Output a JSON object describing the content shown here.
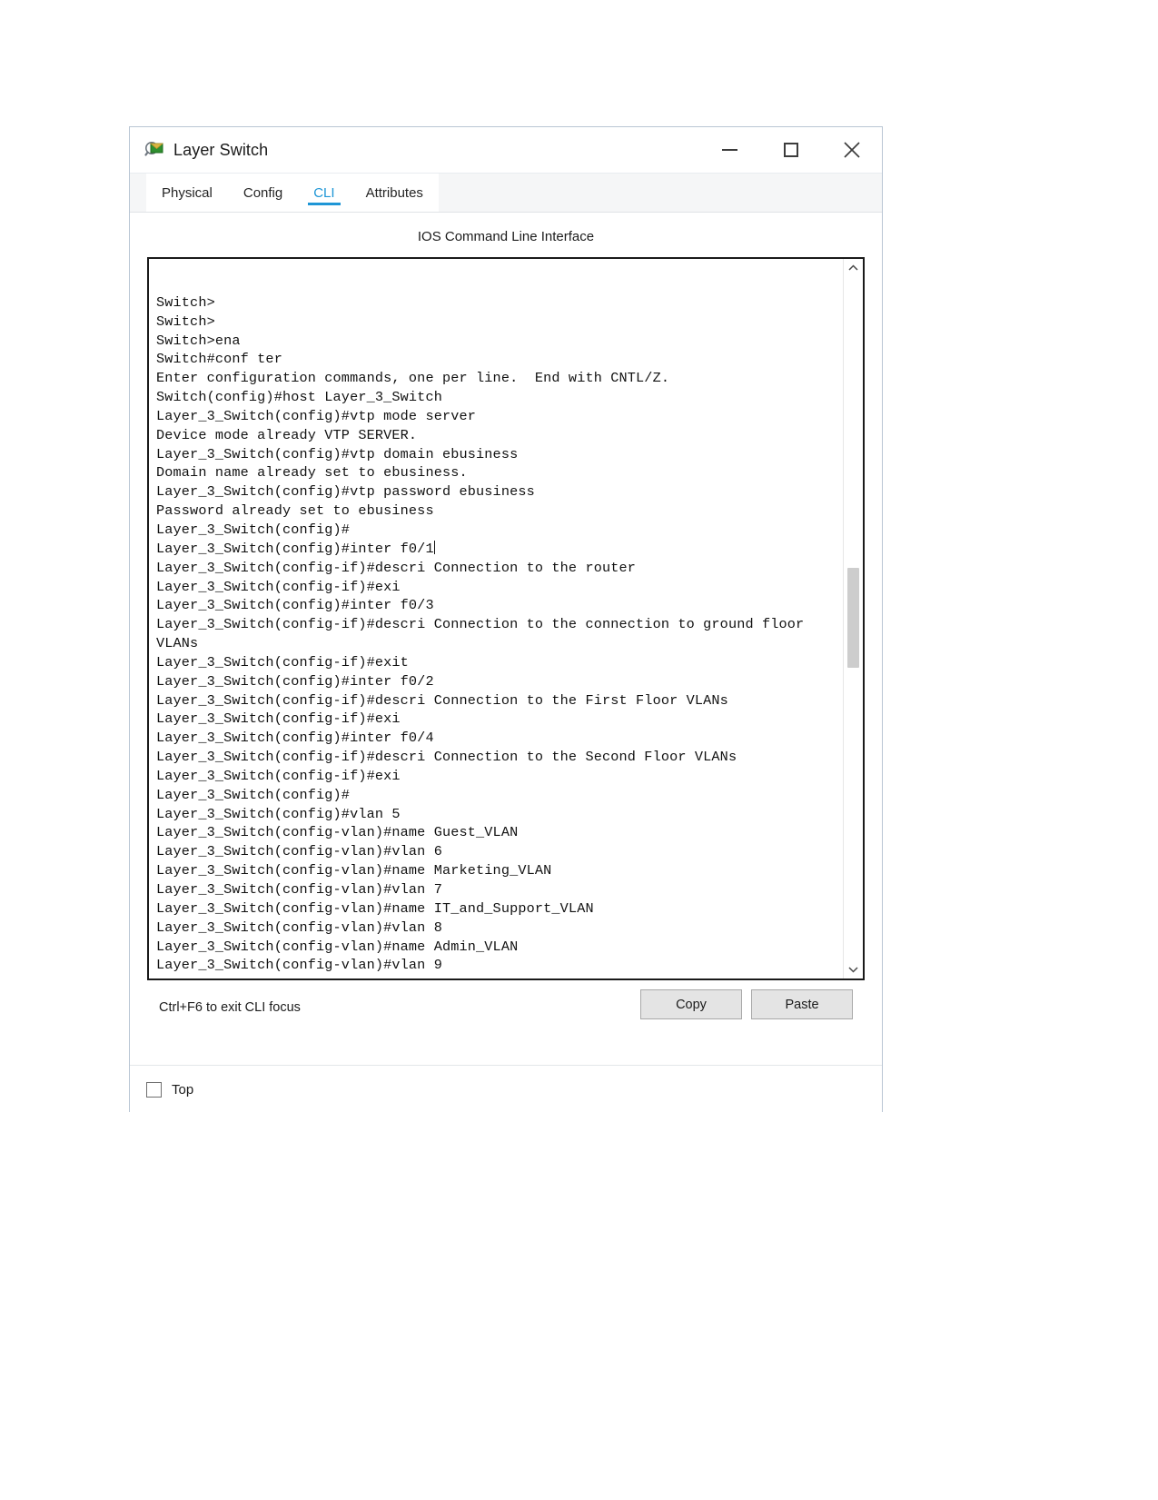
{
  "window": {
    "title": "Layer Switch",
    "icon": "packet-tracer-device-icon",
    "controls": {
      "minimize": "minimize-icon",
      "maximize": "maximize-icon",
      "close": "close-icon"
    }
  },
  "tabs": [
    {
      "label": "Physical",
      "active": false
    },
    {
      "label": "Config",
      "active": false
    },
    {
      "label": "CLI",
      "active": true
    },
    {
      "label": "Attributes",
      "active": false
    }
  ],
  "cli": {
    "heading": "IOS Command Line Interface",
    "hint": "Ctrl+F6 to exit CLI focus",
    "copy_label": "Copy",
    "paste_label": "Paste",
    "accent_color": "#1e96d6",
    "terminal_text": "\nSwitch>\nSwitch>\nSwitch>ena\nSwitch#conf ter\nEnter configuration commands, one per line.  End with CNTL/Z.\nSwitch(config)#host Layer_3_Switch\nLayer_3_Switch(config)#vtp mode server\nDevice mode already VTP SERVER.\nLayer_3_Switch(config)#vtp domain ebusiness\nDomain name already set to ebusiness.\nLayer_3_Switch(config)#vtp password ebusiness\nPassword already set to ebusiness\nLayer_3_Switch(config)#\nLayer_3_Switch(config)#inter f0/1",
    "terminal_text_after_caret": "\nLayer_3_Switch(config-if)#descri Connection to the router\nLayer_3_Switch(config-if)#exi\nLayer_3_Switch(config)#inter f0/3\nLayer_3_Switch(config-if)#descri Connection to the connection to ground floor VLANs\nLayer_3_Switch(config-if)#exit\nLayer_3_Switch(config)#inter f0/2\nLayer_3_Switch(config-if)#descri Connection to the First Floor VLANs\nLayer_3_Switch(config-if)#exi\nLayer_3_Switch(config)#inter f0/4\nLayer_3_Switch(config-if)#descri Connection to the Second Floor VLANs\nLayer_3_Switch(config-if)#exi\nLayer_3_Switch(config)#\nLayer_3_Switch(config)#vlan 5\nLayer_3_Switch(config-vlan)#name Guest_VLAN\nLayer_3_Switch(config-vlan)#vlan 6\nLayer_3_Switch(config-vlan)#name Marketing_VLAN\nLayer_3_Switch(config-vlan)#vlan 7\nLayer_3_Switch(config-vlan)#name IT_and_Support_VLAN\nLayer_3_Switch(config-vlan)#vlan 8\nLayer_3_Switch(config-vlan)#name Admin_VLAN\nLayer_3_Switch(config-vlan)#vlan 9",
    "scrollbar": {
      "up_arrow": "chevron-up-icon",
      "down_arrow": "chevron-down-icon"
    }
  },
  "footer": {
    "top_checkbox_label": "Top",
    "top_checkbox_checked": false
  }
}
